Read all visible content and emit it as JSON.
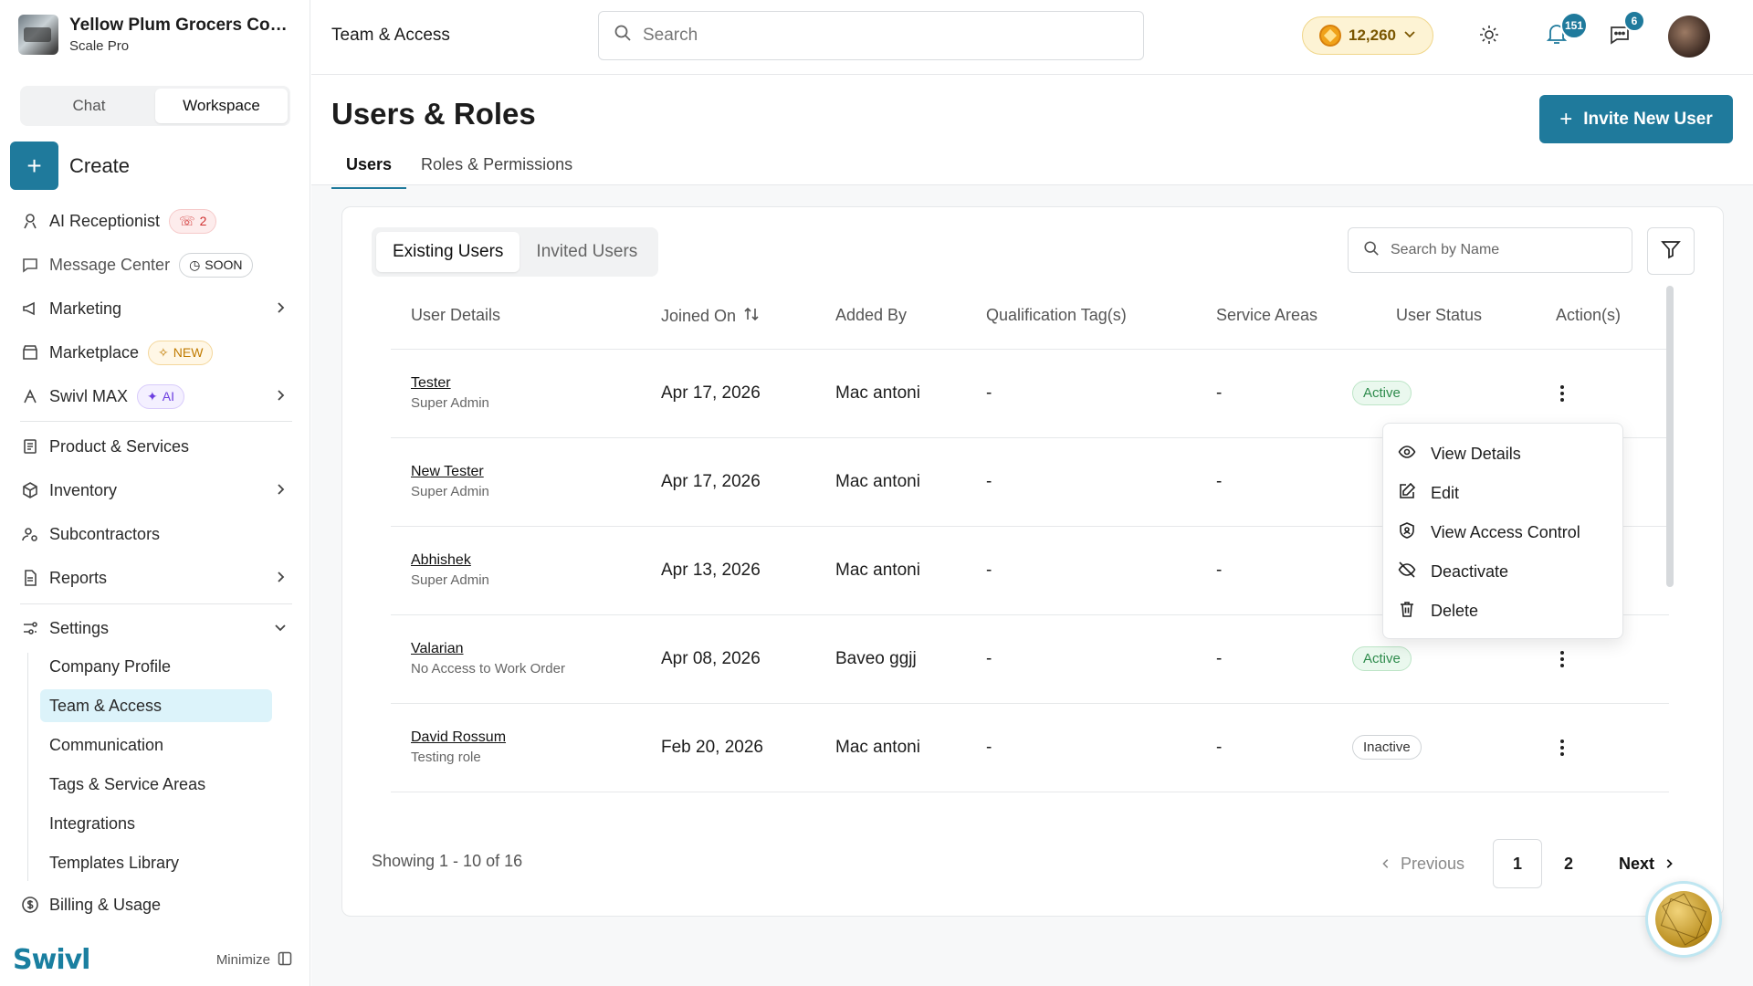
{
  "sidebar": {
    "company_name": "Yellow Plum Grocers Com...",
    "plan": "Scale Pro",
    "mode_tabs": [
      "Chat",
      "Workspace"
    ],
    "create_label": "Create",
    "items": [
      {
        "label": "AI Receptionist",
        "badge": "2",
        "icon": "receptionist-icon"
      },
      {
        "label": "Message Center",
        "badge": "SOON",
        "icon": "message-icon"
      },
      {
        "label": "Marketing",
        "icon": "megaphone-icon"
      },
      {
        "label": "Marketplace",
        "badge": "NEW",
        "icon": "store-icon"
      },
      {
        "label": "Swivl MAX",
        "badge": "AI",
        "icon": "max-icon"
      },
      {
        "label": "Product & Services",
        "icon": "product-icon"
      },
      {
        "label": "Inventory",
        "icon": "box-icon"
      },
      {
        "label": "Subcontractors",
        "icon": "subcontractor-icon"
      },
      {
        "label": "Reports",
        "icon": "report-icon"
      },
      {
        "label": "Settings",
        "icon": "settings-icon"
      },
      {
        "label": "Billing & Usage",
        "icon": "billing-icon"
      }
    ],
    "settings_sub": [
      "Company Profile",
      "Team & Access",
      "Communication",
      "Tags & Service Areas",
      "Integrations",
      "Templates Library"
    ],
    "logo_text": "Swivl",
    "minimize_label": "Minimize"
  },
  "topbar": {
    "breadcrumb": "Team & Access",
    "search_placeholder": "Search",
    "coins": "12,260",
    "notifications": "151",
    "messages": "6"
  },
  "page": {
    "title": "Users & Roles",
    "invite_label": "Invite New User",
    "tabs": [
      "Users",
      "Roles & Permissions"
    ],
    "segments": [
      "Existing Users",
      "Invited Users"
    ],
    "name_search_placeholder": "Search by Name"
  },
  "table": {
    "headers": [
      "User Details",
      "Joined On",
      "Added By",
      "Qualification Tag(s)",
      "Service Areas",
      "User Status",
      "Action(s)"
    ],
    "rows": [
      {
        "name": "Tester",
        "role": "Super Admin",
        "joined": "Apr 17, 2026",
        "added_by": "Mac antoni",
        "tags": "-",
        "areas": "-",
        "status": "Active"
      },
      {
        "name": "New Tester",
        "role": "Super Admin",
        "joined": "Apr 17, 2026",
        "added_by": "Mac antoni",
        "tags": "-",
        "areas": "-",
        "status": ""
      },
      {
        "name": "Abhishek",
        "role": "Super Admin",
        "joined": "Apr 13, 2026",
        "added_by": "Mac antoni",
        "tags": "-",
        "areas": "-",
        "status": ""
      },
      {
        "name": "Valarian",
        "role": "No Access to Work Order",
        "joined": "Apr 08, 2026",
        "added_by": "Baveo ggjj",
        "tags": "-",
        "areas": "-",
        "status": "Active"
      },
      {
        "name": "David Rossum",
        "role": "Testing role",
        "joined": "Feb 20, 2026",
        "added_by": "Mac antoni",
        "tags": "-",
        "areas": "-",
        "status": "Inactive"
      }
    ]
  },
  "menu": {
    "items": [
      "View Details",
      "Edit",
      "View Access Control",
      "Deactivate",
      "Delete"
    ]
  },
  "pagination": {
    "showing": "Showing 1 - 10 of 16",
    "prev": "Previous",
    "pages": [
      "1",
      "2"
    ],
    "next": "Next"
  }
}
